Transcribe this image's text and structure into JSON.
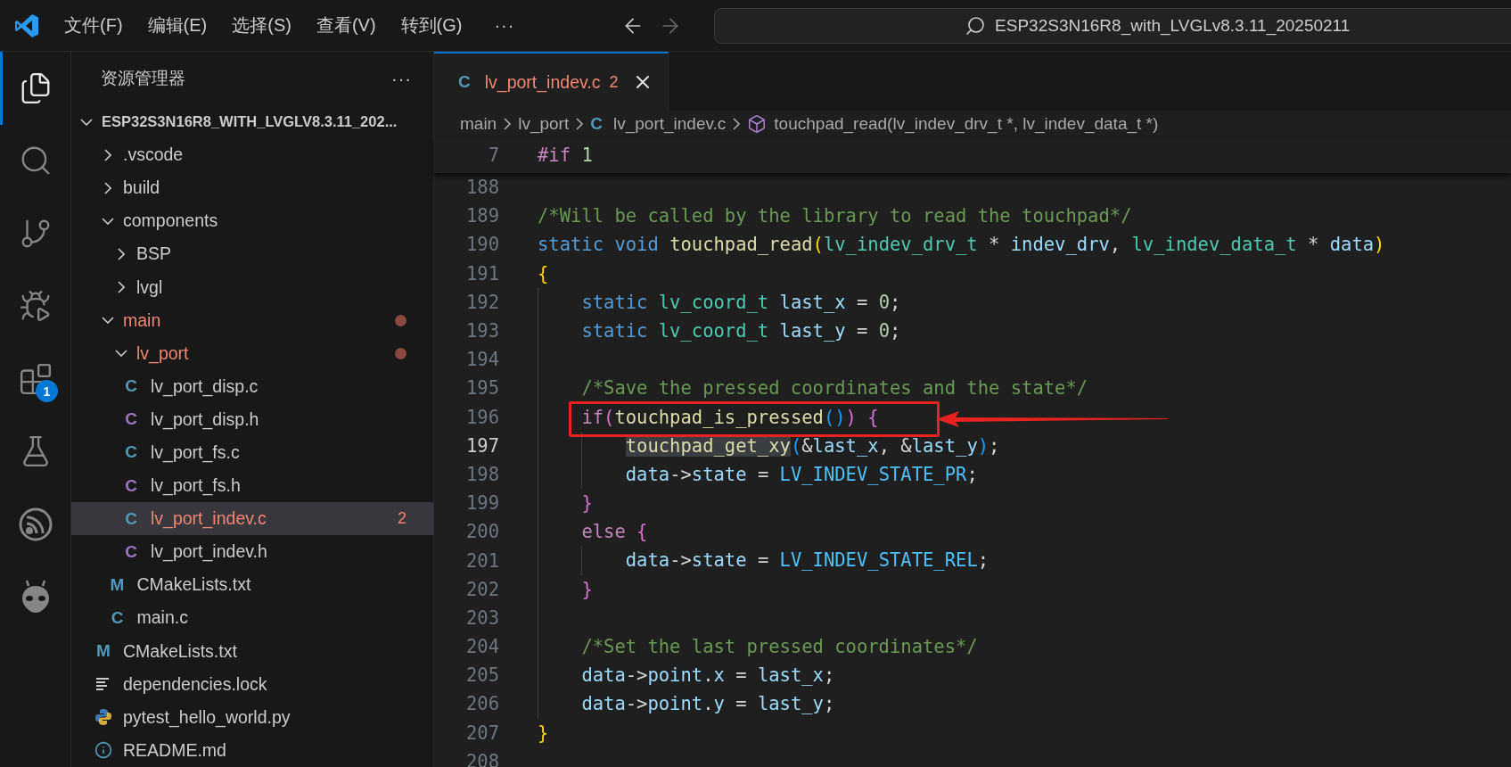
{
  "title_bar": {
    "menus": [
      "文件(F)",
      "编辑(E)",
      "选择(S)",
      "查看(V)",
      "转到(G)"
    ],
    "more": "···",
    "nav": [
      {
        "kind": "back",
        "disabled": false
      },
      {
        "kind": "forward",
        "disabled": true
      }
    ],
    "search_text": "ESP32S3N16R8_with_LVGLv8.3.11_20250211"
  },
  "activity_bar": {
    "items": [
      {
        "kind": "explorer",
        "selected": true
      },
      {
        "kind": "search",
        "selected": false
      },
      {
        "kind": "source-control",
        "selected": false
      },
      {
        "kind": "run-debug",
        "selected": false
      },
      {
        "kind": "extensions",
        "selected": false,
        "badge": "1"
      },
      {
        "kind": "testing",
        "selected": false
      },
      {
        "kind": "espressif",
        "selected": false
      },
      {
        "kind": "platformio",
        "selected": false
      }
    ]
  },
  "sidebar": {
    "title": "资源管理器",
    "more": "···",
    "tree": {
      "name": "ESP32S3N16R8_WITH_LVGLV8.3.11_202...",
      "kind": "root",
      "expanded": true,
      "selected": false,
      "has_errors": false,
      "children": [
        {
          "name": ".vscode",
          "kind": "folder",
          "expanded": false,
          "selected": false,
          "has_errors": false
        },
        {
          "name": "build",
          "kind": "folder",
          "expanded": false,
          "selected": false,
          "has_errors": false
        },
        {
          "name": "components",
          "kind": "folder",
          "expanded": true,
          "selected": false,
          "has_errors": false,
          "children": [
            {
              "name": "BSP",
              "kind": "folder",
              "expanded": false,
              "selected": false,
              "has_errors": false
            },
            {
              "name": "lvgl",
              "kind": "folder",
              "expanded": false,
              "selected": false,
              "has_errors": false
            }
          ]
        },
        {
          "name": "main",
          "kind": "folder",
          "expanded": true,
          "selected": false,
          "has_errors": true,
          "children": [
            {
              "name": "lv_port",
              "kind": "folder",
              "expanded": true,
              "selected": false,
              "has_errors": true,
              "children": [
                {
                  "name": "lv_port_disp.c",
                  "kind": "c",
                  "glyph": "C",
                  "selected": false,
                  "has_errors": false
                },
                {
                  "name": "lv_port_disp.h",
                  "kind": "h",
                  "glyph": "C",
                  "selected": false,
                  "has_errors": false
                },
                {
                  "name": "lv_port_fs.c",
                  "kind": "c",
                  "glyph": "C",
                  "selected": false,
                  "has_errors": false
                },
                {
                  "name": "lv_port_fs.h",
                  "kind": "h",
                  "glyph": "C",
                  "selected": false,
                  "has_errors": false
                },
                {
                  "name": "lv_port_indev.c",
                  "kind": "c",
                  "glyph": "C",
                  "selected": true,
                  "has_errors": true,
                  "badge": "2"
                },
                {
                  "name": "lv_port_indev.h",
                  "kind": "h",
                  "glyph": "C",
                  "selected": false,
                  "has_errors": false
                }
              ]
            },
            {
              "name": "CMakeLists.txt",
              "kind": "cmake",
              "glyph": "M",
              "selected": false,
              "has_errors": false
            },
            {
              "name": "main.c",
              "kind": "c",
              "glyph": "C",
              "selected": false,
              "has_errors": false
            }
          ]
        },
        {
          "name": "CMakeLists.txt",
          "kind": "cmake",
          "glyph": "M",
          "selected": false,
          "has_errors": false
        },
        {
          "name": "dependencies.lock",
          "kind": "lock",
          "selected": false,
          "has_errors": false
        },
        {
          "name": "pytest_hello_world.py",
          "kind": "python",
          "selected": false,
          "has_errors": false
        },
        {
          "name": "README.md",
          "kind": "info",
          "selected": false,
          "has_errors": false
        }
      ]
    }
  },
  "editor": {
    "tabs": [
      {
        "glyph": "C",
        "name": "lv_port_indev.c",
        "badge": "2",
        "has_errors": true,
        "selected": true
      }
    ],
    "breadcrumbs": [
      {
        "kind": "folder",
        "text": "main"
      },
      {
        "kind": "folder",
        "text": "lv_port"
      },
      {
        "kind": "c-file",
        "glyph": "C",
        "text": "lv_port_indev.c"
      },
      {
        "kind": "function",
        "text": "touchpad_read(lv_indev_drv_t *, lv_indev_data_t *)"
      }
    ],
    "sticky_line": {
      "number": "7",
      "tokens": [
        {
          "text": "#if",
          "kind": "control"
        },
        {
          "text": " 1",
          "kind": "number"
        }
      ]
    },
    "lines": [
      {
        "number": "188",
        "current": false
      },
      {
        "number": "189",
        "current": false,
        "tokens": [
          {
            "text": "/*Will be called by the library to read the touchpad*/",
            "kind": "comment"
          }
        ]
      },
      {
        "number": "190",
        "current": false,
        "tokens": [
          {
            "text": "static",
            "kind": "keyword"
          },
          {
            "text": " void",
            "kind": "keyword"
          },
          {
            "text": " touchpad_read",
            "kind": "func"
          },
          {
            "text": "(",
            "kind": "b1"
          },
          {
            "text": "lv_indev_drv_t",
            "kind": "type"
          },
          {
            "text": " *",
            "kind": "plain"
          },
          {
            "text": " indev_drv",
            "kind": "var"
          },
          {
            "text": ",",
            "kind": "plain"
          },
          {
            "text": " lv_indev_data_t",
            "kind": "type"
          },
          {
            "text": " *",
            "kind": "plain"
          },
          {
            "text": " data",
            "kind": "var"
          },
          {
            "text": ")",
            "kind": "b1"
          }
        ]
      },
      {
        "number": "191",
        "current": false,
        "tokens": [
          {
            "text": "{",
            "kind": "b1"
          }
        ]
      },
      {
        "number": "192",
        "current": false,
        "tokens": [
          {
            "text": "    static",
            "kind": "keyword"
          },
          {
            "text": " lv_coord_t",
            "kind": "type"
          },
          {
            "text": " last_x",
            "kind": "var"
          },
          {
            "text": " =",
            "kind": "plain"
          },
          {
            "text": " 0",
            "kind": "number"
          },
          {
            "text": ";",
            "kind": "plain"
          }
        ]
      },
      {
        "number": "193",
        "current": false,
        "tokens": [
          {
            "text": "    static",
            "kind": "keyword"
          },
          {
            "text": " lv_coord_t",
            "kind": "type"
          },
          {
            "text": " last_y",
            "kind": "var"
          },
          {
            "text": " =",
            "kind": "plain"
          },
          {
            "text": " 0",
            "kind": "number"
          },
          {
            "text": ";",
            "kind": "plain"
          }
        ]
      },
      {
        "number": "194",
        "current": false
      },
      {
        "number": "195",
        "current": false,
        "tokens": [
          {
            "text": "    /*Save the pressed coordinates and the state*/",
            "kind": "comment"
          }
        ]
      },
      {
        "number": "196",
        "current": false,
        "tokens": [
          {
            "text": "    if",
            "kind": "control"
          },
          {
            "text": "(",
            "kind": "b2"
          },
          {
            "text": "touchpad_is_pressed",
            "kind": "func"
          },
          {
            "text": "()",
            "kind": "b3"
          },
          {
            "text": ")",
            "kind": "b2"
          },
          {
            "text": " {",
            "kind": "b2"
          }
        ]
      },
      {
        "number": "197",
        "current": true,
        "tokens": [
          {
            "text": "        touchpad_get_xy",
            "kind": "match"
          },
          {
            "text": "(",
            "kind": "b3"
          },
          {
            "text": "&",
            "kind": "plain"
          },
          {
            "text": "last_x",
            "kind": "var"
          },
          {
            "text": ", &",
            "kind": "plain"
          },
          {
            "text": "last_y",
            "kind": "var"
          },
          {
            "text": ")",
            "kind": "b3"
          },
          {
            "text": ";",
            "kind": "plain"
          }
        ]
      },
      {
        "number": "198",
        "current": false,
        "tokens": [
          {
            "text": "        data",
            "kind": "var"
          },
          {
            "text": "->",
            "kind": "plain"
          },
          {
            "text": "state",
            "kind": "var"
          },
          {
            "text": " =",
            "kind": "plain"
          },
          {
            "text": " LV_INDEV_STATE_PR",
            "kind": "macro"
          },
          {
            "text": ";",
            "kind": "plain"
          }
        ]
      },
      {
        "number": "199",
        "current": false,
        "tokens": [
          {
            "text": "    }",
            "kind": "b2"
          }
        ]
      },
      {
        "number": "200",
        "current": false,
        "tokens": [
          {
            "text": "    else",
            "kind": "control"
          },
          {
            "text": " {",
            "kind": "b2"
          }
        ]
      },
      {
        "number": "201",
        "current": false,
        "tokens": [
          {
            "text": "        data",
            "kind": "var"
          },
          {
            "text": "->",
            "kind": "plain"
          },
          {
            "text": "state",
            "kind": "var"
          },
          {
            "text": " =",
            "kind": "plain"
          },
          {
            "text": " LV_INDEV_STATE_REL",
            "kind": "macro"
          },
          {
            "text": ";",
            "kind": "plain"
          }
        ]
      },
      {
        "number": "202",
        "current": false,
        "tokens": [
          {
            "text": "    }",
            "kind": "b2"
          }
        ]
      },
      {
        "number": "203",
        "current": false
      },
      {
        "number": "204",
        "current": false,
        "tokens": [
          {
            "text": "    /*Set the last pressed coordinates*/",
            "kind": "comment"
          }
        ]
      },
      {
        "number": "205",
        "current": false,
        "tokens": [
          {
            "text": "    data",
            "kind": "var"
          },
          {
            "text": "->",
            "kind": "plain"
          },
          {
            "text": "point",
            "kind": "var"
          },
          {
            "text": ".",
            "kind": "plain"
          },
          {
            "text": "x",
            "kind": "var"
          },
          {
            "text": " =",
            "kind": "plain"
          },
          {
            "text": " last_x",
            "kind": "var"
          },
          {
            "text": ";",
            "kind": "plain"
          }
        ]
      },
      {
        "number": "206",
        "current": false,
        "tokens": [
          {
            "text": "    data",
            "kind": "var"
          },
          {
            "text": "->",
            "kind": "plain"
          },
          {
            "text": "point",
            "kind": "var"
          },
          {
            "text": ".",
            "kind": "plain"
          },
          {
            "text": "y",
            "kind": "var"
          },
          {
            "text": " =",
            "kind": "plain"
          },
          {
            "text": " last_y",
            "kind": "var"
          },
          {
            "text": ";",
            "kind": "plain"
          }
        ]
      },
      {
        "number": "207",
        "current": false,
        "tokens": [
          {
            "text": "}",
            "kind": "b1"
          }
        ]
      },
      {
        "number": "208",
        "current": false
      }
    ]
  }
}
